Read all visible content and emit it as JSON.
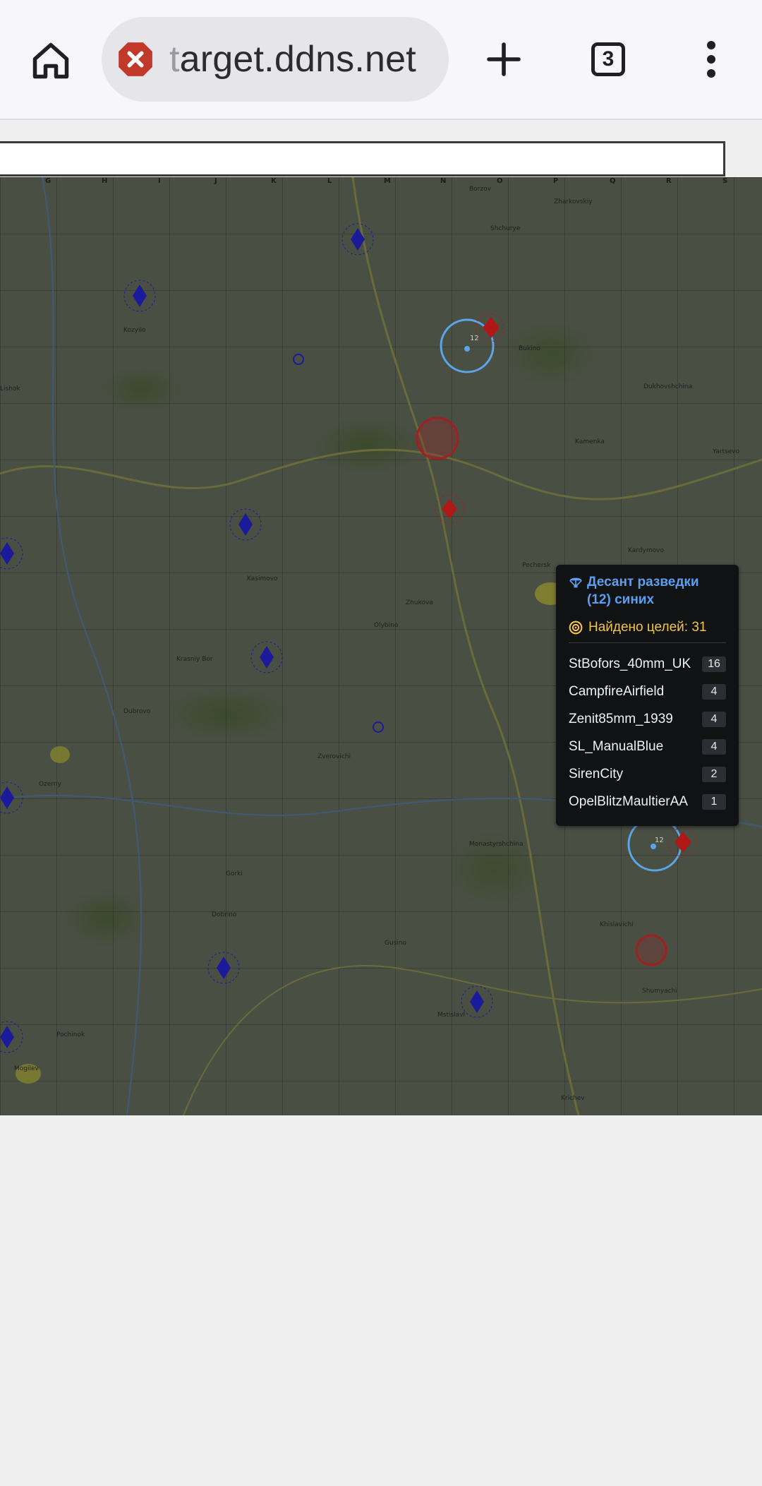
{
  "browser": {
    "url_hidden": "t",
    "url_visible": "arget.ddns.net",
    "tab_count": "3",
    "icons": [
      "home-icon",
      "site-error-icon",
      "new-tab-icon",
      "tab-switcher-icon",
      "more-menu-icon"
    ],
    "error_color": "#c0392b"
  },
  "page": {
    "input_value": ""
  },
  "map": {
    "column_labels": [
      "G",
      "H",
      "I",
      "J",
      "K",
      "L",
      "M",
      "N",
      "O",
      "P",
      "Q",
      "R",
      "S"
    ],
    "town_labels": [
      "Borzov",
      "Zharkovskiy",
      "Shchurye",
      "Kozyilo",
      "Bukino",
      "Dukhovshchina",
      "Lishok",
      "Kamenka",
      "Kardymovo",
      "Yartsevo",
      "Pechersk",
      "Zhukova",
      "Kasimovo",
      "Olybino",
      "Krasniy Bor",
      "Dubrovo",
      "Zverovichi",
      "Ozerny",
      "Monastyrshchina",
      "Khislavichi",
      "Gorki",
      "Dobrino",
      "Gusino",
      "Mstislavl",
      "Pochinok",
      "Shumyachi",
      "Mogilev",
      "Krichev"
    ],
    "unit_label": "12",
    "colors": {
      "blue_marker": "#1a1a9a",
      "red_marker": "#b01818",
      "ring_blue": "#5aa6e8",
      "ring_red": "#a02020"
    }
  },
  "popup": {
    "title": "Десант разведки (12) синих",
    "title_icon": "parachute-icon",
    "found_label": "Найдено целей: 31",
    "found_icon": "target-icon",
    "title_color": "#5aa0f2",
    "found_color": "#f2c54a",
    "items": [
      {
        "name": "StBofors_40mm_UK",
        "count": "16"
      },
      {
        "name": "CampfireAirfield",
        "count": "4"
      },
      {
        "name": "Zenit85mm_1939",
        "count": "4"
      },
      {
        "name": "SL_ManualBlue",
        "count": "4"
      },
      {
        "name": "SirenCity",
        "count": "2"
      },
      {
        "name": "OpelBlitzMaultierAA",
        "count": "1"
      }
    ]
  }
}
